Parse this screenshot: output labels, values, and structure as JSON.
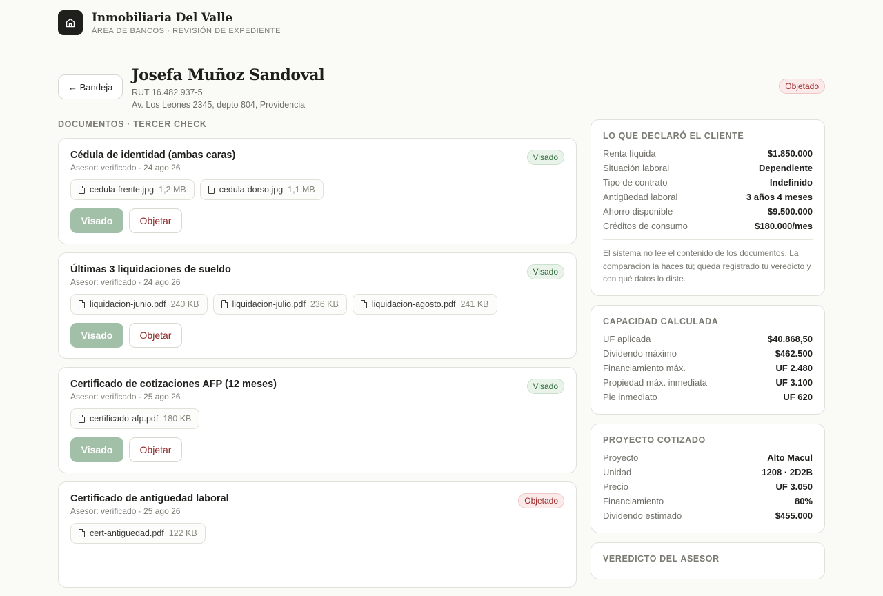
{
  "app": {
    "title": "Inmobiliaria Del Valle",
    "subtitle": "Área de bancos · Revisión de expediente"
  },
  "header": {
    "back_label": "← Bandeja",
    "client_name": "Josefa Muñoz Sandoval",
    "rut": "RUT 16.482.937-5",
    "address": "Av. Los Leones 2345, depto 804, Providencia",
    "status": "Objetado"
  },
  "documents": {
    "section_label": "DOCUMENTOS · TERCER CHECK",
    "items": [
      {
        "title": "Cédula de identidad (ambas caras)",
        "meta": "Asesor: verificado · 24 ago 26",
        "status": "Visado",
        "files": [
          {
            "name": "cedula-frente.jpg",
            "size": "1,2 MB"
          },
          {
            "name": "cedula-dorso.jpg",
            "size": "1,1 MB"
          }
        ],
        "approve_label": "Visado",
        "reject_label": "Objetar"
      },
      {
        "title": "Últimas 3 liquidaciones de sueldo",
        "meta": "Asesor: verificado · 24 ago 26",
        "status": "Visado",
        "files": [
          {
            "name": "liquidacion-junio.pdf",
            "size": "240 KB"
          },
          {
            "name": "liquidacion-julio.pdf",
            "size": "236 KB"
          },
          {
            "name": "liquidacion-agosto.pdf",
            "size": "241 KB"
          }
        ],
        "approve_label": "Visado",
        "reject_label": "Objetar"
      },
      {
        "title": "Certificado de cotizaciones AFP (12 meses)",
        "meta": "Asesor: verificado · 25 ago 26",
        "status": "Visado",
        "files": [
          {
            "name": "certificado-afp.pdf",
            "size": "180 KB"
          }
        ],
        "approve_label": "Visado",
        "reject_label": "Objetar"
      },
      {
        "title": "Certificado de antigüedad laboral",
        "meta": "Asesor: verificado · 25 ago 26",
        "status": "Objetado",
        "files": [
          {
            "name": "cert-antiguedad.pdf",
            "size": "122 KB"
          }
        ]
      }
    ]
  },
  "declared": {
    "title": "LO QUE DECLARÓ EL CLIENTE",
    "rows": [
      {
        "k": "Renta líquida",
        "v": "$1.850.000"
      },
      {
        "k": "Situación laboral",
        "v": "Dependiente"
      },
      {
        "k": "Tipo de contrato",
        "v": "Indefinido"
      },
      {
        "k": "Antigüedad laboral",
        "v": "3 años 4 meses"
      },
      {
        "k": "Ahorro disponible",
        "v": "$9.500.000"
      },
      {
        "k": "Créditos de consumo",
        "v": "$180.000/mes"
      }
    ],
    "note": "El sistema no lee el contenido de los documentos. La comparación la haces tú; queda registrado tu veredicto y con qué datos lo diste."
  },
  "capacity": {
    "title": "CAPACIDAD CALCULADA",
    "rows": [
      {
        "k": "UF aplicada",
        "v": "$40.868,50"
      },
      {
        "k": "Dividendo máximo",
        "v": "$462.500"
      },
      {
        "k": "Financiamiento máx.",
        "v": "UF 2.480"
      },
      {
        "k": "Propiedad máx. inmediata",
        "v": "UF 3.100"
      },
      {
        "k": "Pie inmediato",
        "v": "UF 620"
      }
    ]
  },
  "project": {
    "title": "PROYECTO COTIZADO",
    "rows": [
      {
        "k": "Proyecto",
        "v": "Alto Macul"
      },
      {
        "k": "Unidad",
        "v": "1208 · 2D2B"
      },
      {
        "k": "Precio",
        "v": "UF 3.050"
      },
      {
        "k": "Financiamiento",
        "v": "80%"
      },
      {
        "k": "Dividendo estimado",
        "v": "$455.000"
      }
    ]
  },
  "verdict": {
    "title": "VEREDICTO DEL ASESOR"
  }
}
